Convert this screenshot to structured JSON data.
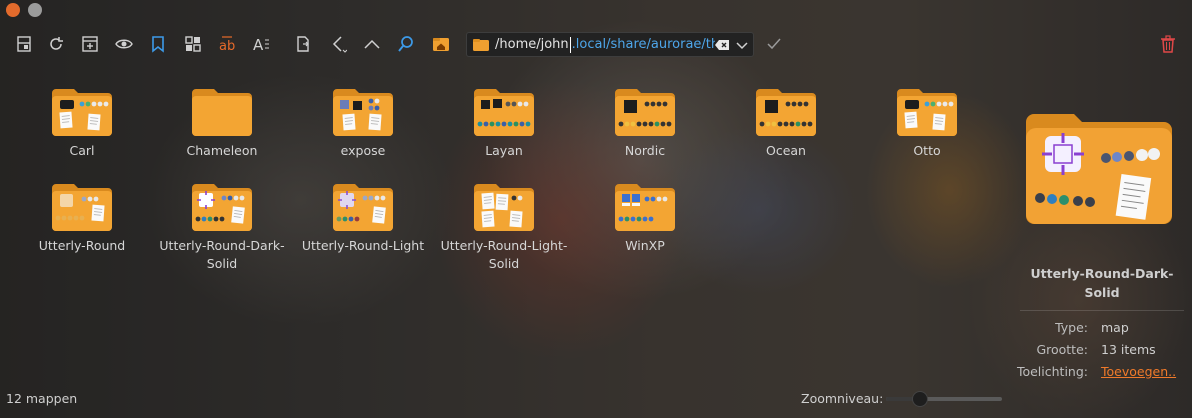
{
  "window": {
    "close_color": "#e36b2c",
    "minimize_color": "#9b9b9b"
  },
  "toolbar": {
    "buttons": [
      {
        "name": "split-view-icon"
      },
      {
        "name": "reload-icon"
      },
      {
        "name": "new-tab-icon"
      },
      {
        "name": "show-hidden-icon"
      },
      {
        "name": "bookmark-icon"
      },
      {
        "name": "view-mode-icon"
      },
      {
        "name": "rename-icon"
      },
      {
        "name": "font-icon"
      },
      {
        "name": "copy-location-icon"
      },
      {
        "name": "back-icon"
      },
      {
        "name": "up-icon"
      },
      {
        "name": "search-icon"
      },
      {
        "name": "home-icon"
      }
    ],
    "confirm_icon": "check-icon",
    "trash_icon": "trash-icon"
  },
  "address": {
    "path_base": "/home/john",
    "path_rest": ".local/share/aurorae/the",
    "accent": "#4ea6ea"
  },
  "folders": [
    {
      "label": "Carl",
      "style": "dark-round"
    },
    {
      "label": "Chameleon",
      "style": "plain"
    },
    {
      "label": "expose",
      "style": "mixed"
    },
    {
      "label": "Layan",
      "style": "dark-square"
    },
    {
      "label": "Nordic",
      "style": "dark-single"
    },
    {
      "label": "Ocean",
      "style": "dark-single"
    },
    {
      "label": "Otto",
      "style": "dark-round"
    },
    {
      "label": "Utterly-Round",
      "style": "light-square"
    },
    {
      "label": "Utterly-Round-Dark-Solid",
      "style": "cross"
    },
    {
      "label": "Utterly-Round-Light",
      "style": "cross-light"
    },
    {
      "label": "Utterly-Round-Light-Solid",
      "style": "paper"
    },
    {
      "label": "WinXP",
      "style": "xp"
    }
  ],
  "info": {
    "selected_name": "Utterly-Round-Dark-Solid",
    "type_label": "Type:",
    "type_value": "map",
    "size_label": "Grootte:",
    "size_value": "13 items",
    "comment_label": "Toelichting:",
    "comment_value": "Toevoegen..",
    "link_color": "#f07a2a"
  },
  "status": {
    "count": "12 mappen",
    "zoom_label": "Zoomniveau:",
    "zoom_level": 0.29
  }
}
